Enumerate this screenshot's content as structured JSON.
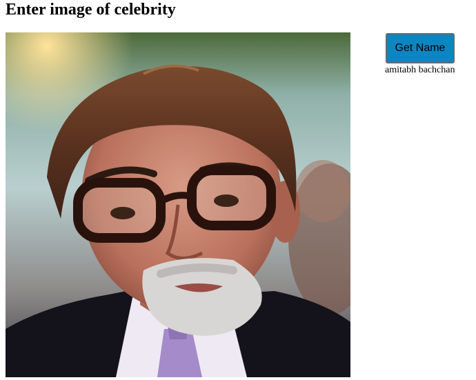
{
  "page": {
    "title": "Enter image of celebrity"
  },
  "photo": {
    "subject_icon": "portrait-photo"
  },
  "actions": {
    "get_name_label": "Get Name"
  },
  "result": {
    "name": "amitabh bachchan"
  },
  "colors": {
    "button_bg": "#0b86c0",
    "button_border": "#5f6c73",
    "text": "#000000",
    "background": "#ffffff"
  }
}
